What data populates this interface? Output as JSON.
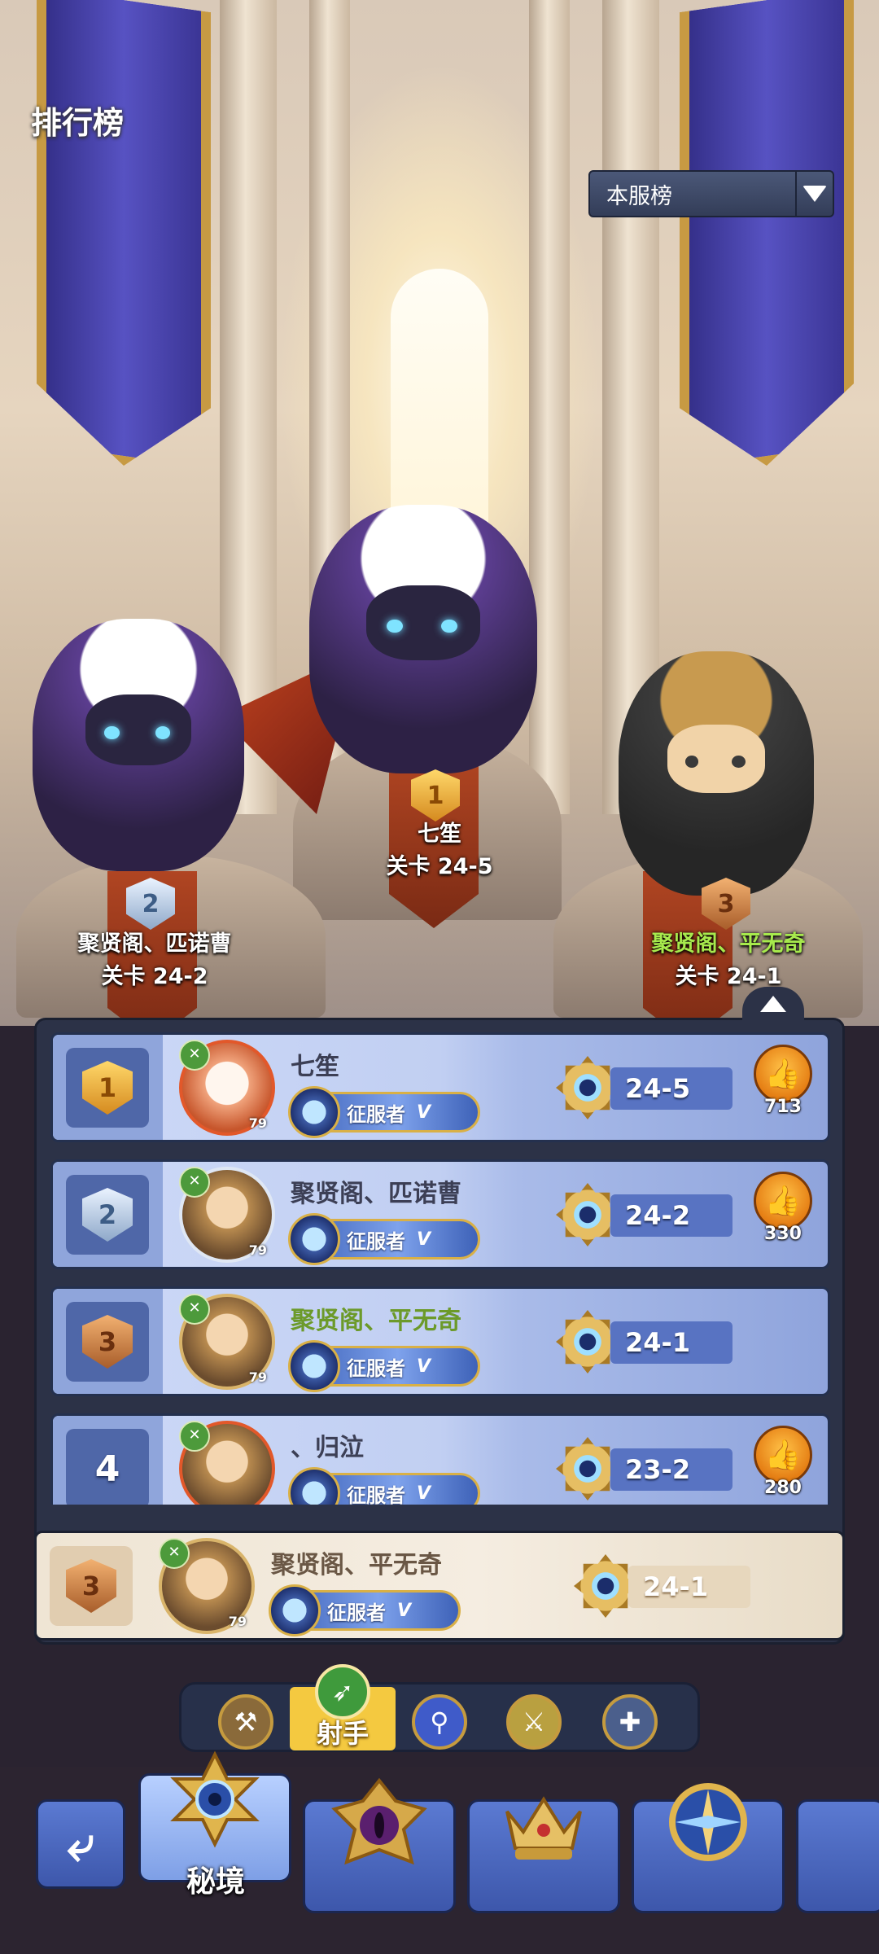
{
  "header": {
    "title": "排行榜"
  },
  "scope_dropdown": {
    "selected": "本服榜"
  },
  "podium": [
    {
      "rank": "1",
      "name": "七笙",
      "stage": "关卡 24-5"
    },
    {
      "rank": "2",
      "name": "聚贤阁、匹诺曹",
      "stage": "关卡 24-2"
    },
    {
      "rank": "3",
      "name": "聚贤阁、平无奇",
      "stage": "关卡 24-1"
    }
  ],
  "rows": [
    {
      "rank": "1",
      "name": "七笙",
      "level": "79",
      "title": "征服者",
      "tier": "V",
      "stage": "24-5",
      "likes": "713"
    },
    {
      "rank": "2",
      "name": "聚贤阁、匹诺曹",
      "level": "79",
      "title": "征服者",
      "tier": "V",
      "stage": "24-2",
      "likes": "330"
    },
    {
      "rank": "3",
      "name": "聚贤阁、平无奇",
      "level": "79",
      "title": "征服者",
      "tier": "V",
      "stage": "24-1",
      "likes": ""
    },
    {
      "rank": "4",
      "name": "、归泣",
      "level": "",
      "title": "征服者",
      "tier": "V",
      "stage": "23-2",
      "likes": "280"
    }
  ],
  "my_row": {
    "rank": "3",
    "name": "聚贤阁、平无奇",
    "level": "79",
    "title": "征服者",
    "tier": "V",
    "stage": "24-1"
  },
  "class_filter": {
    "selected_label": "射手",
    "items": [
      "warrior-axe-icon",
      "archer-bow-icon",
      "mage-staff-icon",
      "assassin-blade-icon",
      "support-cross-icon"
    ]
  },
  "bottom_nav": {
    "selected_label": "秘境"
  },
  "colors": {
    "accent_gold": "#f4c940",
    "row_blue": "#c1cff2",
    "panel": "#2c3247",
    "my_row": "#f5ede1",
    "green_name": "#6c9a2a"
  }
}
